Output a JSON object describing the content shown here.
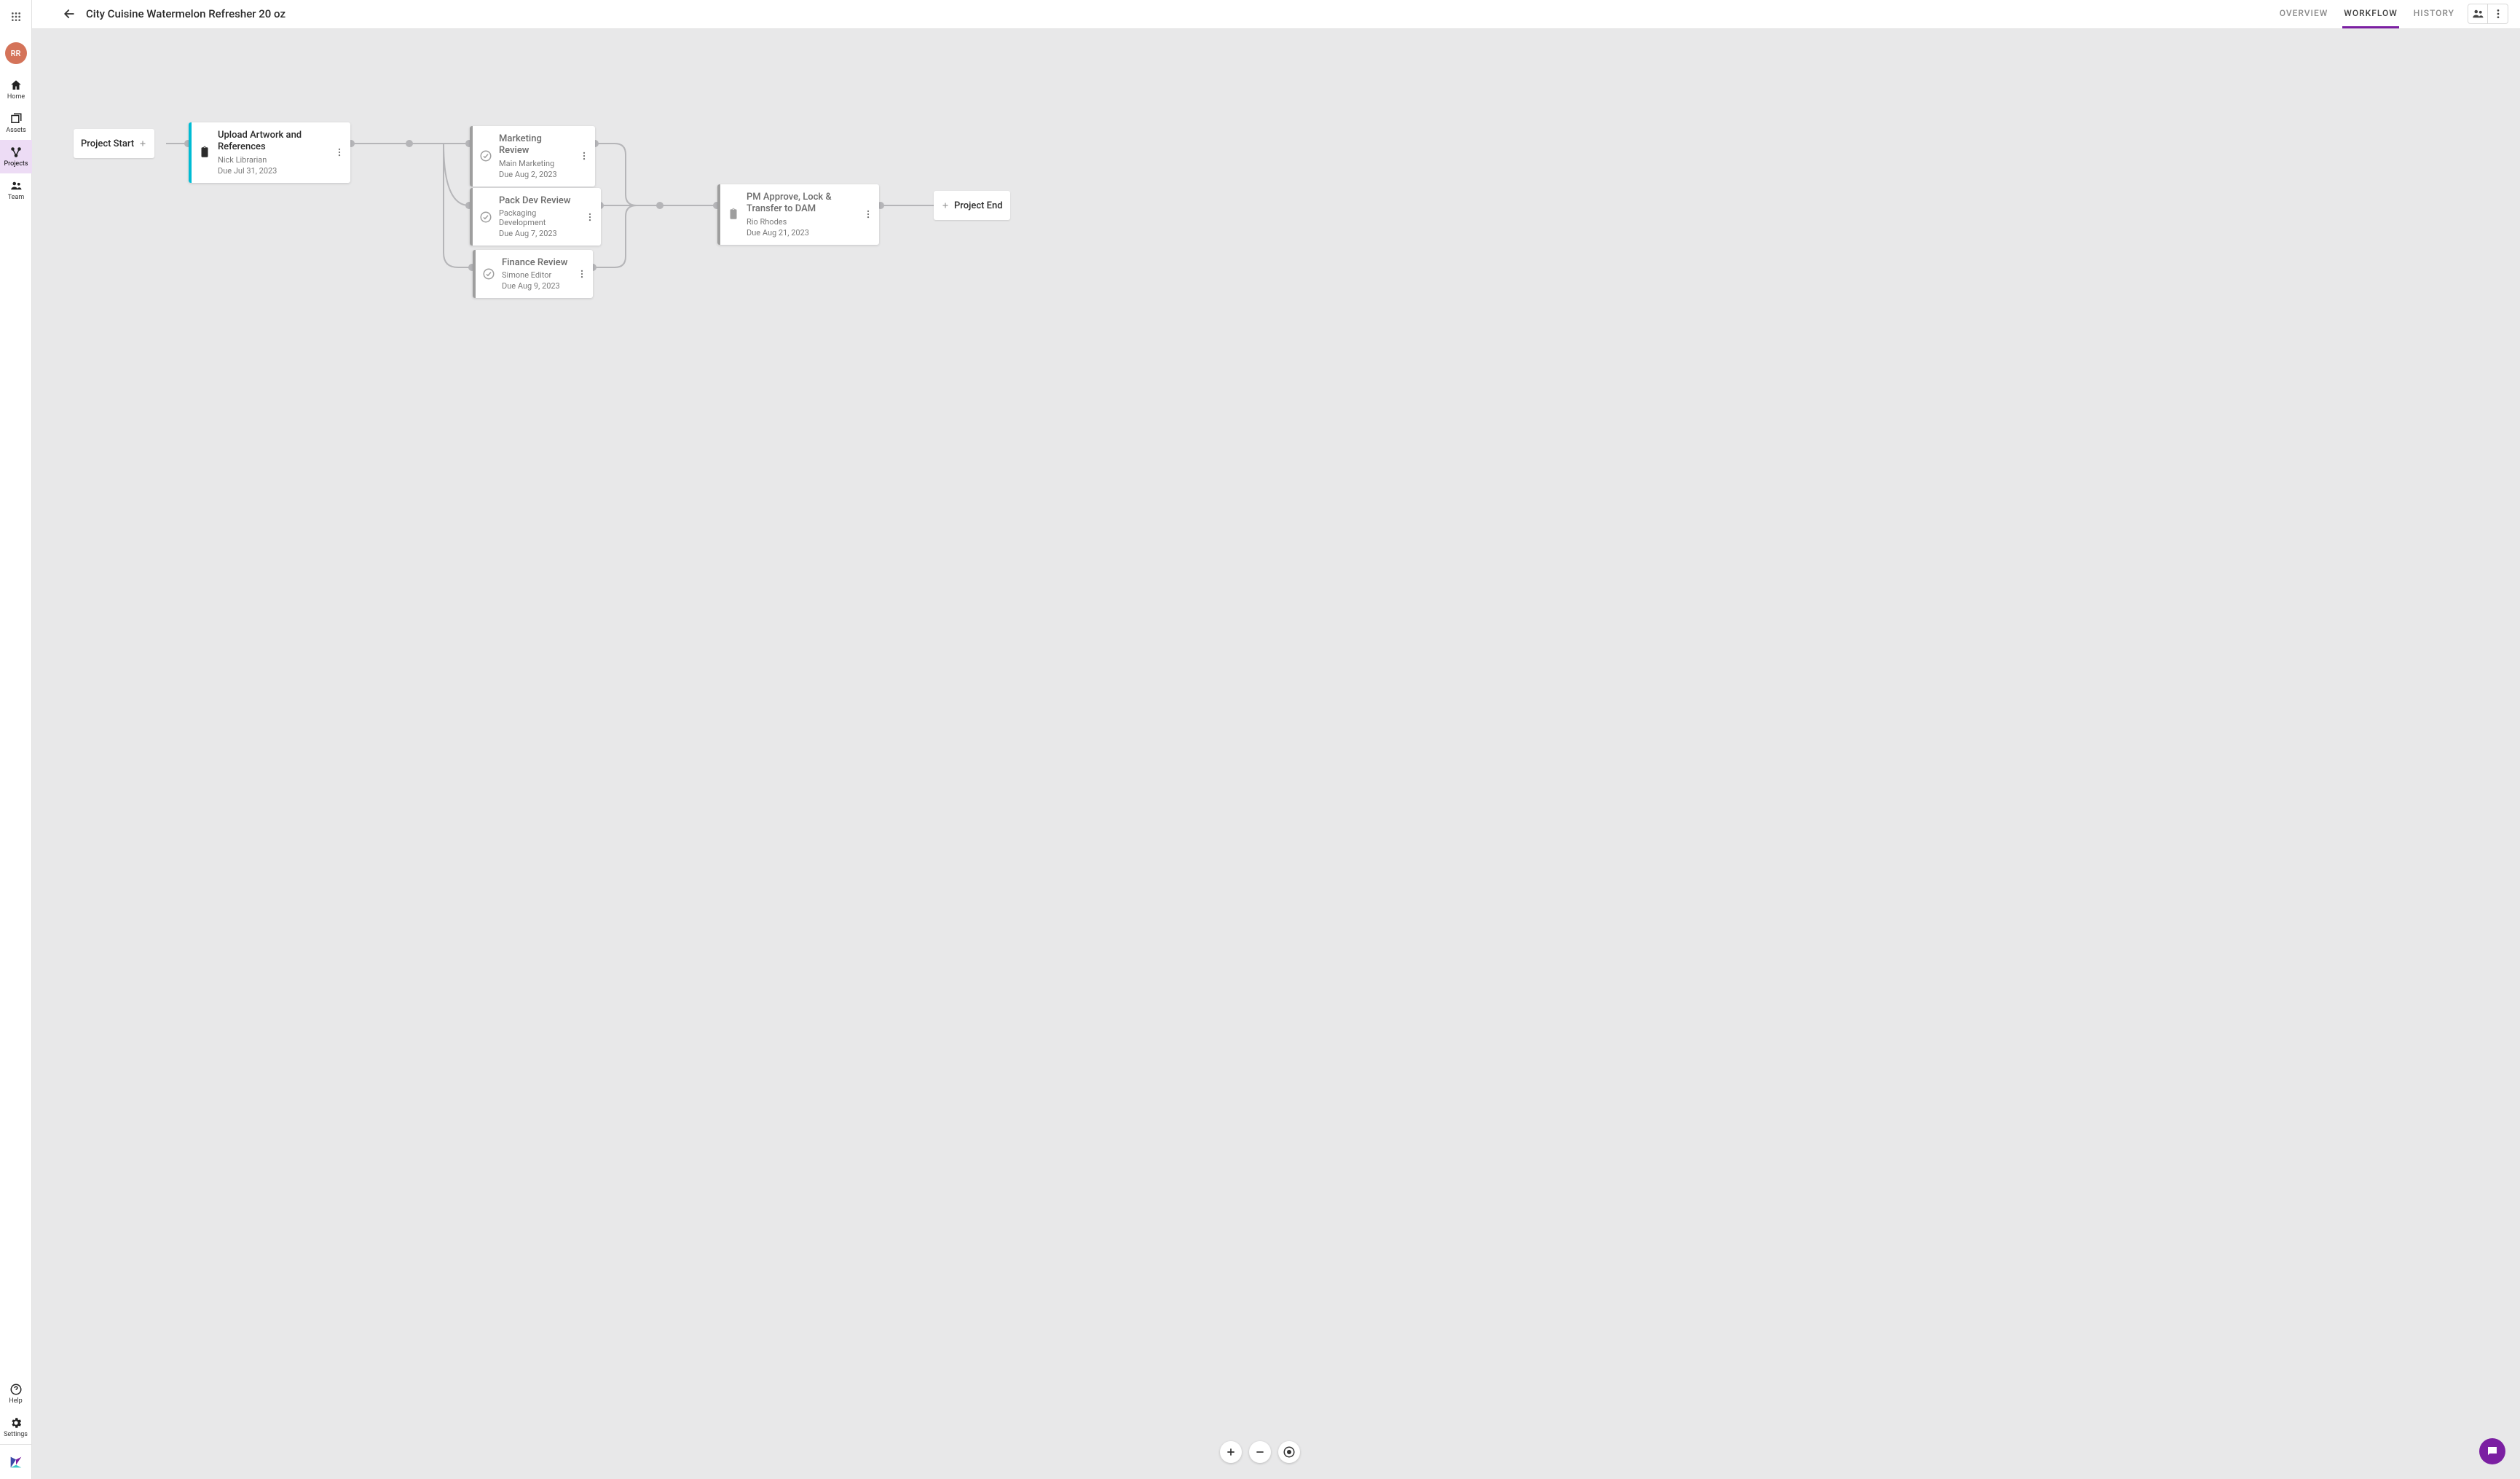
{
  "sidebar": {
    "avatar_initials": "RR",
    "items": [
      {
        "label": "Home",
        "icon": "home-icon"
      },
      {
        "label": "Assets",
        "icon": "assets-icon"
      },
      {
        "label": "Projects",
        "icon": "projects-icon",
        "active": true
      },
      {
        "label": "Team",
        "icon": "team-icon"
      }
    ],
    "bottom": [
      {
        "label": "Help",
        "icon": "help-icon"
      },
      {
        "label": "Settings",
        "icon": "settings-icon"
      }
    ]
  },
  "header": {
    "title": "City Cuisine Watermelon Refresher 20 oz",
    "tabs": [
      {
        "label": "OVERVIEW"
      },
      {
        "label": "WORKFLOW",
        "active": true
      },
      {
        "label": "HISTORY"
      }
    ]
  },
  "workflow": {
    "start_label": "Project Start",
    "end_label": "Project End",
    "nodes": {
      "upload": {
        "title": "Upload Artwork and References",
        "assignee": "Nick Librarian",
        "due": "Due Jul 31, 2023",
        "bar_color": "#00bcd4",
        "type": "task"
      },
      "marketing": {
        "title": "Marketing Review",
        "assignee": "Main Marketing",
        "due": "Due Aug 2, 2023",
        "bar_color": "#9e9e9e",
        "type": "review"
      },
      "packdev": {
        "title": "Pack Dev Review",
        "assignee": "Packaging Development",
        "due": "Due Aug 7, 2023",
        "bar_color": "#9e9e9e",
        "type": "review"
      },
      "finance": {
        "title": "Finance Review",
        "assignee": "Simone Editor",
        "due": "Due Aug 9, 2023",
        "bar_color": "#9e9e9e",
        "type": "review"
      },
      "pm": {
        "title": "PM Approve, Lock & Transfer to DAM",
        "assignee": "Rio Rhodes",
        "due": "Due Aug 21, 2023",
        "bar_color": "#9e9e9e",
        "type": "task"
      }
    }
  }
}
